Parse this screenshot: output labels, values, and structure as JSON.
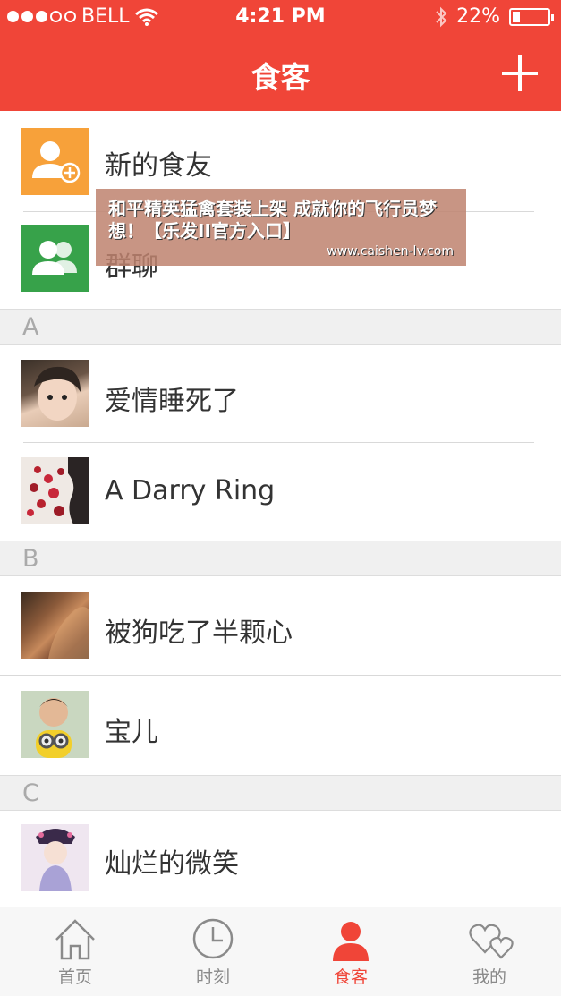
{
  "status": {
    "carrier": "BELL",
    "time": "4:21 PM",
    "battery": "22%",
    "battery_level": 0.22
  },
  "nav": {
    "title": "食客"
  },
  "special": [
    {
      "label": "新的食友",
      "color": "#f7a13a"
    },
    {
      "label": "群聊",
      "color": "#37a24a"
    }
  ],
  "sections": [
    {
      "letter": "A",
      "contacts": [
        {
          "name": "爱情睡死了"
        },
        {
          "name": "A Darry Ring"
        }
      ]
    },
    {
      "letter": "B",
      "contacts": [
        {
          "name": "被狗吃了半颗心"
        },
        {
          "name": "宝儿"
        }
      ]
    },
    {
      "letter": "C",
      "contacts": [
        {
          "name": "灿烂的微笑"
        }
      ]
    }
  ],
  "ad": {
    "text": "和平精英猛禽套装上架 成就你的飞行员梦想！【乐发II官方入口】",
    "url": "www.caishen-lv.com"
  },
  "tabs": [
    {
      "label": "首页",
      "icon": "house-icon"
    },
    {
      "label": "时刻",
      "icon": "clock-icon"
    },
    {
      "label": "食客",
      "icon": "person-icon"
    },
    {
      "label": "我的",
      "icon": "hearts-icon"
    }
  ],
  "colors": {
    "accent": "#f04538"
  }
}
